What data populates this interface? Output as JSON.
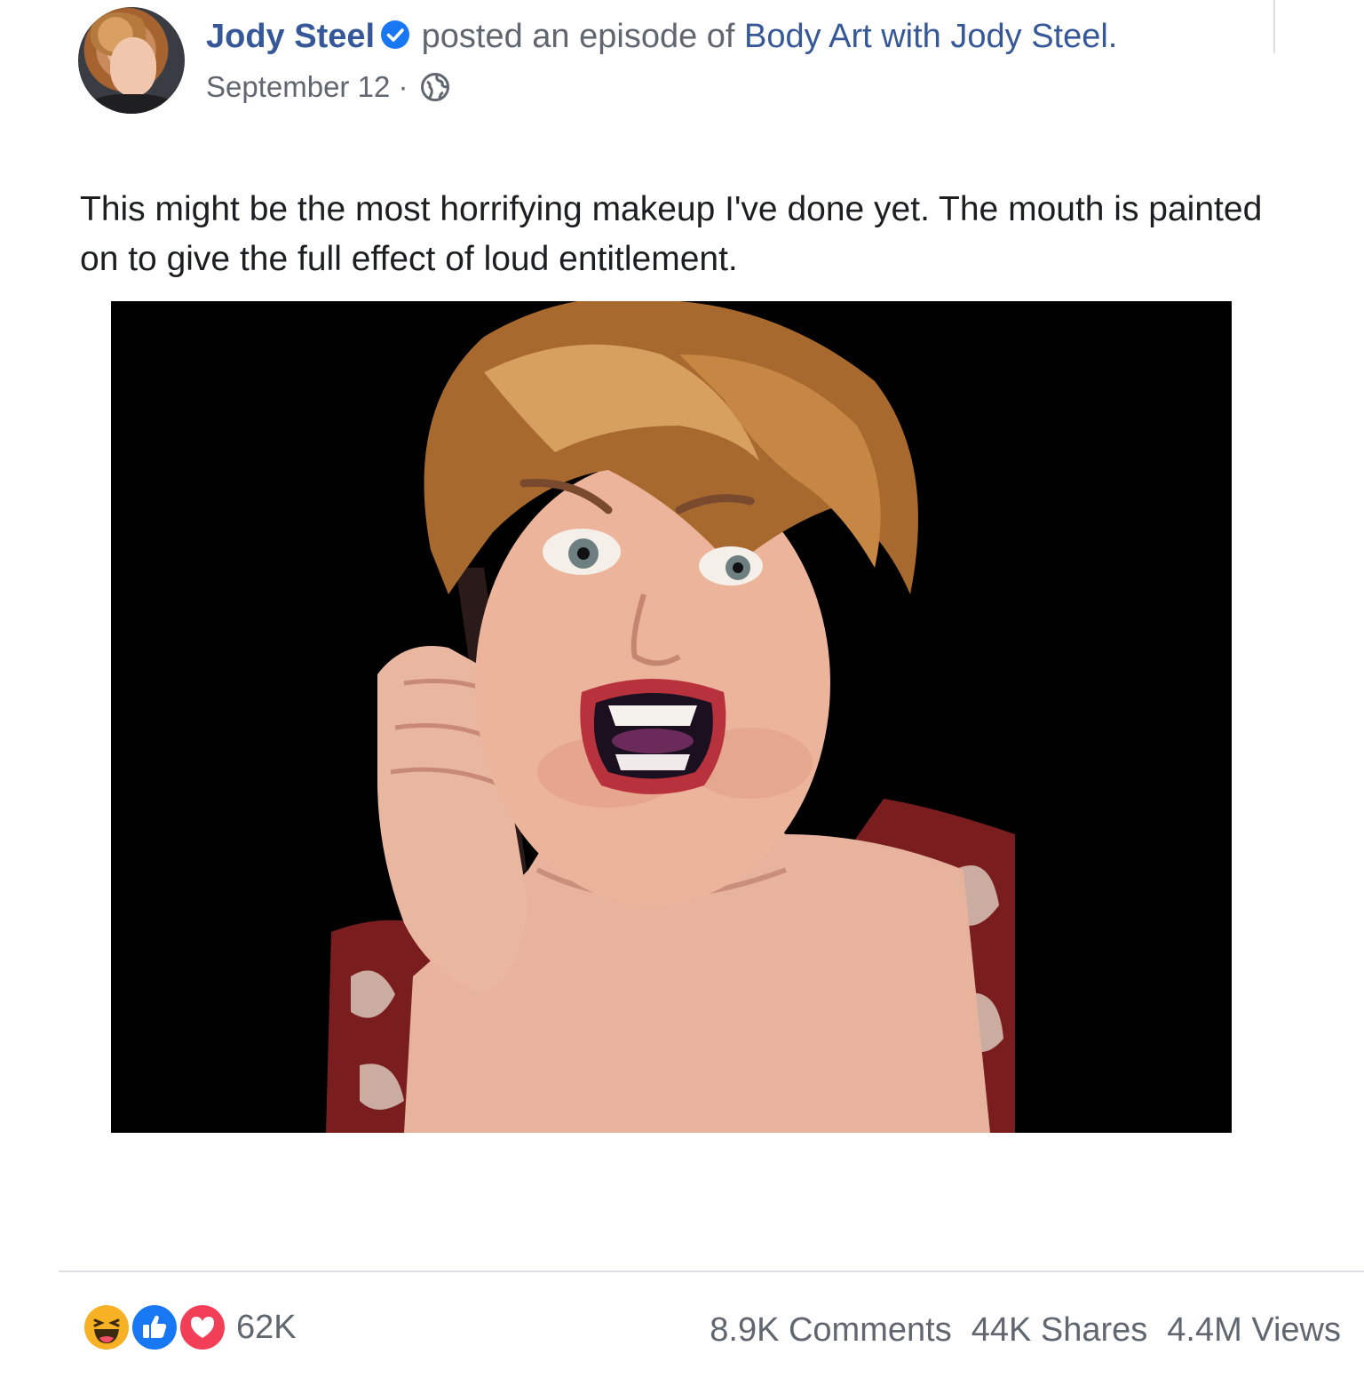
{
  "post": {
    "author": "Jody Steel",
    "action_text": "posted an episode of",
    "show_name": "Body Art with Jody Steel.",
    "date": "September 12",
    "separator": "·",
    "caption": "This might be the most horrifying makeup I've done yet. The mouth is painted on to give the full effect of loud entitlement."
  },
  "icons": {
    "verified": "verified-badge-icon",
    "privacy": "globe-icon",
    "reactions": [
      "haha-reaction-icon",
      "like-reaction-icon",
      "love-reaction-icon"
    ]
  },
  "footer": {
    "reaction_count": "62K",
    "comments": "8.9K Comments",
    "shares": "44K Shares",
    "views": "4.4M Views"
  },
  "colors": {
    "link": "#365899",
    "secondary_text": "#606770",
    "verified": "#1877f2",
    "like": "#1877f2",
    "love": "#f33e58",
    "haha": "#f7b125"
  }
}
